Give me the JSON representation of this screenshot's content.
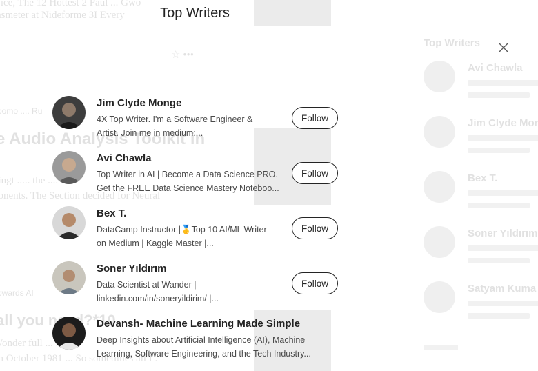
{
  "modal": {
    "title": "Top Writers",
    "writers": [
      {
        "name": "Jim Clyde Monge",
        "bio_line1": "4X Top Writer. I'm a Software Engineer &",
        "bio_line2": "Artist. Join me in medium:...",
        "follow_label": "Follow"
      },
      {
        "name": "Avi Chawla",
        "bio_line1": "Top Writer in AI | Become a Data Science PRO.",
        "bio_line2": "Get the FREE Data Science Mastery Noteboo...",
        "follow_label": "Follow"
      },
      {
        "name": "Bex T.",
        "bio_line1": "DataCamp Instructor |🥇Top 10 AI/ML Writer",
        "bio_line2": "on Medium | Kaggle Master |...",
        "follow_label": "Follow"
      },
      {
        "name": "Soner Yıldırım",
        "bio_line1": "Data Scientist at Wander |",
        "bio_line2": "linkedin.com/in/soneryildirim/ |...",
        "follow_label": "Follow"
      },
      {
        "name": "Devansh- Machine Learning Made Simple",
        "bio_line1": "Deep Insights about Artificial Intelligence (AI), Machine",
        "bio_line2": "Learning, Software Engineering, and the Tech Industry...",
        "follow_label": null
      }
    ]
  },
  "background_page": {
    "sidebar_title": "Top Writers",
    "sidebar_names": [
      "Avi Chawla",
      "Jim Clyde Mon",
      "Bex T.",
      "Soner Yıldırım",
      "Satyam Kuma"
    ],
    "headline1": "e Audio Analysis Toolkit in",
    "headline2": "all you need?*10"
  },
  "icons": {
    "close": "close-icon"
  }
}
